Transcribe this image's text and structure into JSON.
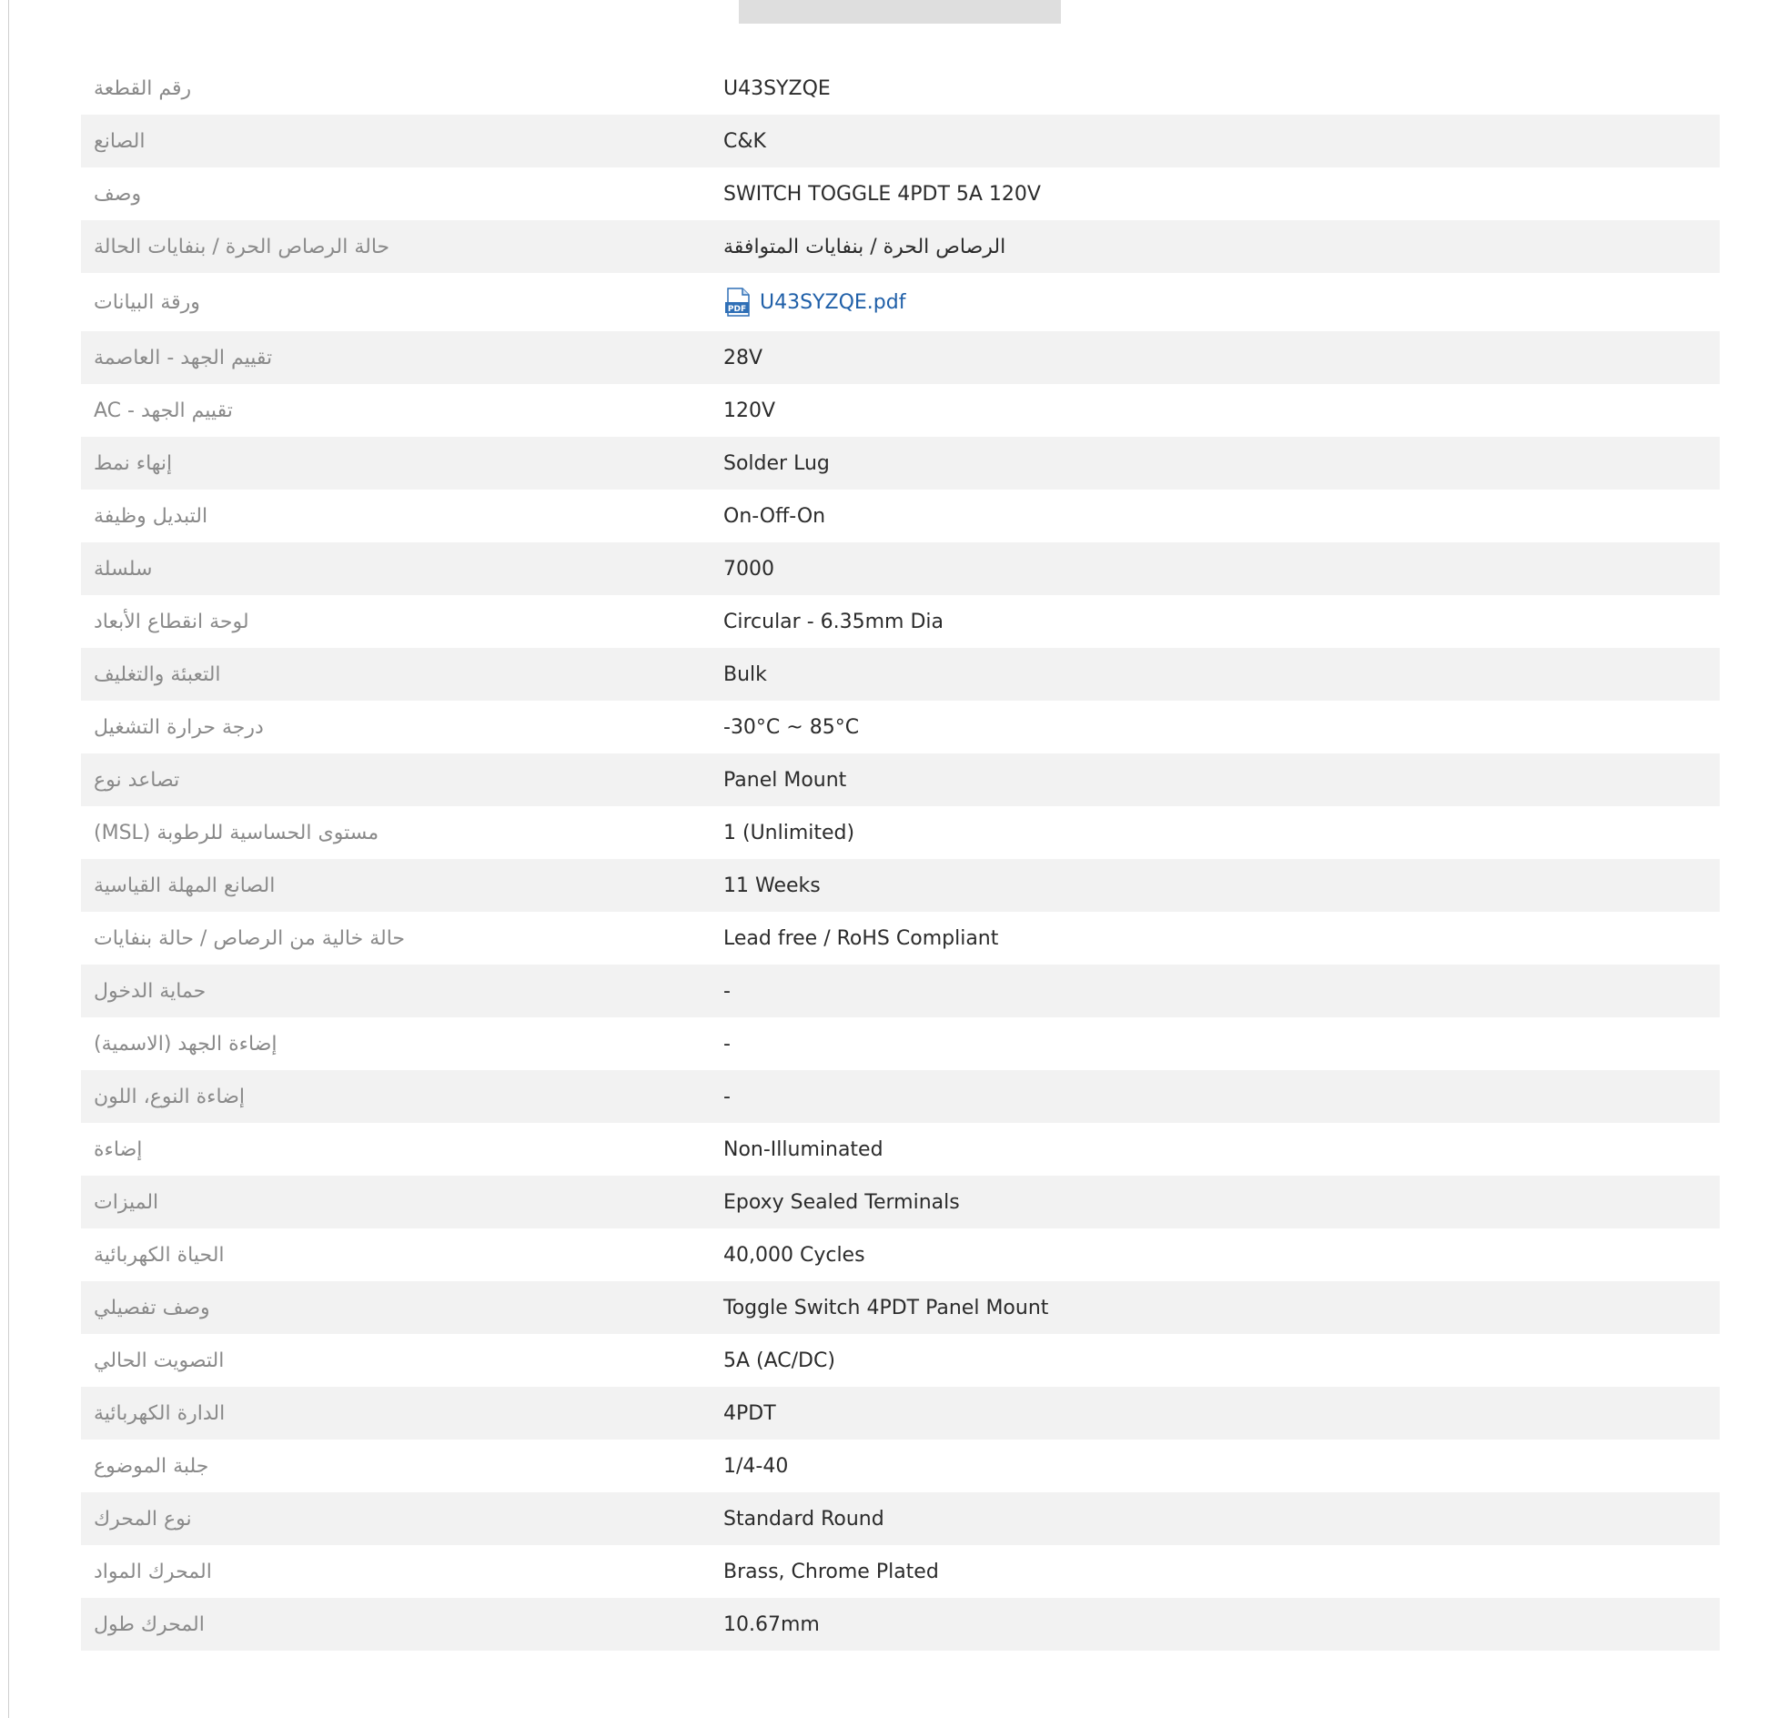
{
  "datasheet": {
    "label": "ورقة البيانات",
    "file": "U43SYZQE.pdf",
    "icon": "pdf-icon",
    "icon_text": "PDF"
  },
  "specs": [
    {
      "label": "رقم القطعة",
      "value": "U43SYZQE"
    },
    {
      "label": "الصانع",
      "value": "C&K"
    },
    {
      "label": "وصف",
      "value": "SWITCH TOGGLE 4PDT 5A 120V"
    },
    {
      "label": "حالة الرصاص الحرة / بنفايات الحالة",
      "value": "الرصاص الحرة / بنفايات المتوافقة"
    },
    {
      "label": "تقييم الجهد - العاصمة",
      "value": "28V"
    },
    {
      "label": "AC - تقييم الجهد",
      "value": "120V"
    },
    {
      "label": "إنهاء نمط",
      "value": "Solder Lug"
    },
    {
      "label": "التبديل وظيفة",
      "value": "On-Off-On"
    },
    {
      "label": "سلسلة",
      "value": "7000"
    },
    {
      "label": "لوحة انقطاع الأبعاد",
      "value": "Circular - 6.35mm Dia"
    },
    {
      "label": "التعبئة والتغليف",
      "value": "Bulk"
    },
    {
      "label": "درجة حرارة التشغيل",
      "value": "-30°C ~ 85°C"
    },
    {
      "label": "تصاعد نوع",
      "value": "Panel Mount"
    },
    {
      "label": "(MSL) مستوى الحساسية للرطوبة",
      "value": "1 (Unlimited)"
    },
    {
      "label": "الصانع المهلة القياسية",
      "value": "11 Weeks"
    },
    {
      "label": "حالة خالية من الرصاص / حالة بنفايات",
      "value": "Lead free / RoHS Compliant"
    },
    {
      "label": "حماية الدخول",
      "value": "-"
    },
    {
      "label": "(إضاءة الجهد (الاسمية",
      "value": "-"
    },
    {
      "label": "إضاءة النوع، اللون",
      "value": "-"
    },
    {
      "label": "إضاءة",
      "value": "Non-Illuminated"
    },
    {
      "label": "الميزات",
      "value": "Epoxy Sealed Terminals"
    },
    {
      "label": "الحياة الكهربائية",
      "value": "40,000 Cycles"
    },
    {
      "label": "وصف تفصيلي",
      "value": "Toggle Switch 4PDT Panel Mount"
    },
    {
      "label": "التصويت الحالي",
      "value": "5A (AC/DC)"
    },
    {
      "label": "الدارة الكهربائية",
      "value": "4PDT"
    },
    {
      "label": "جلبة الموضوع",
      "value": "1/4-40"
    },
    {
      "label": "نوع المحرك",
      "value": "Standard Round"
    },
    {
      "label": "المحرك المواد",
      "value": "Brass, Chrome Plated"
    },
    {
      "label": "المحرك طول",
      "value": "10.67mm"
    }
  ],
  "colors": {
    "row_alt": "#f2f2f2",
    "label": "#8a8a8a",
    "value": "#2b2b2b",
    "link": "#1f5fa8"
  }
}
